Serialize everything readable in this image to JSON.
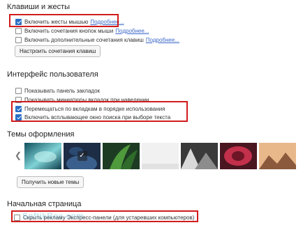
{
  "keys_section": {
    "title": "Клавиши и жесты",
    "options": [
      {
        "label": "Включить жесты мышью",
        "link": "Подробнее...",
        "checked": true
      },
      {
        "label": "Включить сочетания кнопок мыши",
        "link": "Подробнее...",
        "checked": false
      },
      {
        "label": "Включить дополнительные сочетания клавиш",
        "link": "Подробнее...",
        "checked": false
      }
    ],
    "button_label": "Настроить сочетания клавиш"
  },
  "ui_section": {
    "title": "Интерфейс пользователя",
    "options": [
      {
        "label": "Показывать панель закладок",
        "checked": false
      },
      {
        "label": "Показывать миниатюры вкладок при наведении",
        "checked": false
      },
      {
        "label": "Перемещаться по вкладкам в порядке использования",
        "checked": true
      },
      {
        "label": "Включить всплывающее окно поиска при выборе текста",
        "checked": true
      }
    ]
  },
  "themes_section": {
    "title": "Темы оформления",
    "arrow_icon": "chevron-left-icon",
    "selected_index": 1,
    "button_label": "Получить новые темы"
  },
  "start_section": {
    "title": "Начальная страница",
    "option_text": "Скрыть рекламу Экспресс-панели (для устаревших компьютеров)"
  },
  "watermark": "SoftikBox.com",
  "colors": {
    "highlight": "#d11b1b",
    "checkbox_checked": "#2a6fc6",
    "link": "#3a67c9"
  }
}
